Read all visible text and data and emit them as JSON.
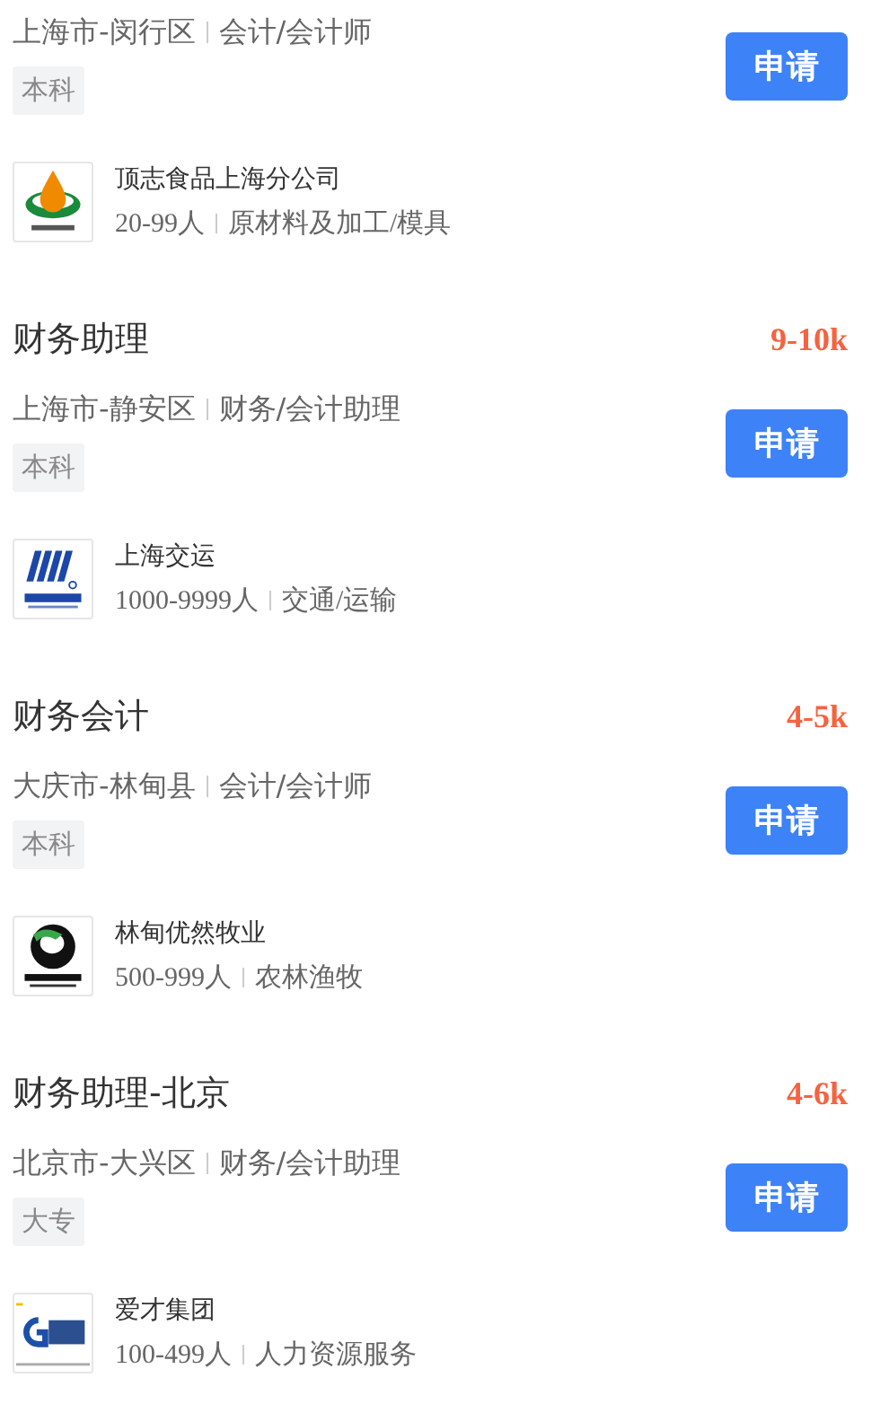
{
  "jobs": [
    {
      "location": "上海市-闵行区",
      "category": "会计/会计师",
      "education": "本科",
      "apply": "申请",
      "company": {
        "name": "顶志食品上海分公司",
        "logo": {
          "kind": "drop"
        },
        "size": "20-99人",
        "industry": "原材料及加工/模具"
      }
    },
    {
      "title": "财务助理",
      "salary": "9-10k",
      "location": "上海市-静安区",
      "category": "财务/会计助理",
      "education": "本科",
      "apply": "申请",
      "company": {
        "name": "上海交运",
        "logo": {
          "kind": "stripes"
        },
        "size": "1000-9999人",
        "industry": "交通/运输"
      }
    },
    {
      "title": "财务会计",
      "salary": "4-5k",
      "location": "大庆市-林甸县",
      "category": "会计/会计师",
      "education": "本科",
      "apply": "申请",
      "company": {
        "name": "林甸优然牧业",
        "logo": {
          "kind": "cow"
        },
        "size": "500-999人",
        "industry": "农林渔牧"
      }
    },
    {
      "title": "财务助理-北京",
      "salary": "4-6k",
      "location": "北京市-大兴区",
      "category": "财务/会计助理",
      "education": "大专",
      "apply": "申请",
      "company": {
        "name": "爱才集团",
        "logo": {
          "kind": "letter"
        },
        "size": "100-499人",
        "industry": "人力资源服务"
      }
    }
  ]
}
